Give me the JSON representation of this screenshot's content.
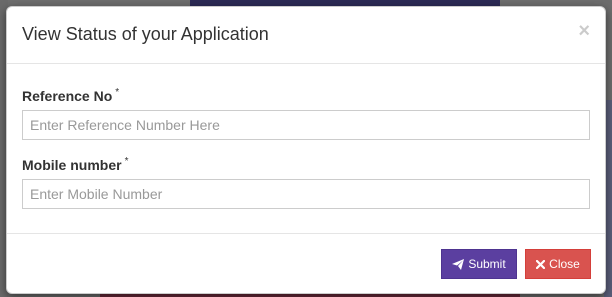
{
  "modal": {
    "title": "View Status of your Application",
    "close_glyph": "×"
  },
  "form": {
    "reference": {
      "label": "Reference No",
      "required_mark": "*",
      "placeholder": "Enter Reference Number Here",
      "value": ""
    },
    "mobile": {
      "label": "Mobile number",
      "required_mark": "*",
      "placeholder": "Enter Mobile Number",
      "value": ""
    }
  },
  "footer": {
    "submit_label": "Submit",
    "submit_icon": "paper-plane-icon",
    "close_label": "Close",
    "close_icon": "times-icon"
  },
  "colors": {
    "submit_bg": "#5b3fa0",
    "close_bg": "#d9534f"
  }
}
